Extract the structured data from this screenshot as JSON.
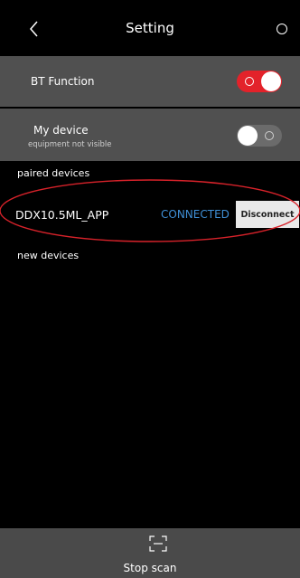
{
  "header": {
    "title": "Setting",
    "back_icon": "chevron-left-icon",
    "action_icon": "circle-icon"
  },
  "bt_function": {
    "label": "BT Function",
    "enabled": true,
    "color": "#e3222a"
  },
  "my_device": {
    "label": "My device",
    "sublabel": "equipment not visible",
    "enabled": false
  },
  "sections": {
    "paired": "paired devices",
    "new": "new devices"
  },
  "paired_devices": [
    {
      "name": "DDX10.5ML_APP",
      "status": "CONNECTED",
      "status_color": "#3f8fd6",
      "action": "Disconnect"
    }
  ],
  "bottom_bar": {
    "label": "Stop scan",
    "icon": "scan-icon"
  }
}
